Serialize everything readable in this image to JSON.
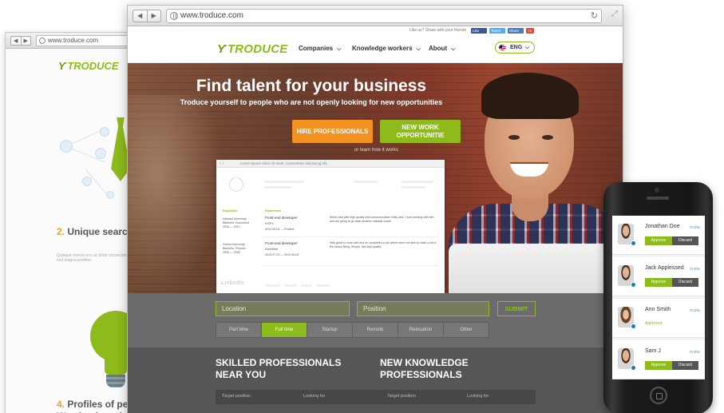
{
  "back_browser": {
    "url": "www.troduce.com",
    "logo_text": "TRODUCE",
    "section2": {
      "number": "2.",
      "text": "Unique search capabilities"
    },
    "section2_small": "Quisque viverra orci ac dolor consectetur adipiscing elit. Sed molestie id mi velyu at sed magna porttitor.",
    "section4": {
      "number": "4.",
      "text": "Profiles of perfect high quality. We check each profile ma"
    }
  },
  "browser": {
    "url": "www.troduce.com",
    "topbar": {
      "share_text": "Like us? Share with your friends",
      "like": "Like",
      "tweet": "Tweet",
      "share": "Share",
      "plus": "+1"
    },
    "header": {
      "logo_text": "TRODUCE",
      "menu": [
        "Companies",
        "Knowledge workers",
        "About"
      ],
      "lang": "ENG"
    },
    "hero": {
      "title": "Find talent for your business",
      "subtitle": "Troduce yourself to people who are not openly looking for new opportunities",
      "hire_button": "HIRE PROFESSIONALS",
      "new_work_button": "NEW WORK OPPORTUNITIE",
      "learn_link": "or learn how it works"
    },
    "resume_card": {
      "bar_text": "Lorem ipsum dolor sit amet, consectetur adipiscing elit.",
      "education_label": "Education",
      "experience_label": "Experience",
      "edu1": "Harvard University\nBachelor, Economist\n2005 — 2010",
      "edu2": "Oxford University\nBachelor, Physics\n2000 — 2005",
      "job1": "Front-end developer",
      "job1_company": "IHOPx",
      "job1_dates": "2012-05-04 — Present",
      "job2": "Front-end developer",
      "job2_company": "EarthWeb",
      "job2_dates": "2010-07-23 — 2012-05-04",
      "job1_desc": "Works fast with high quality and communicative really well. I love working with him and am going to go back another rockstar coder!",
      "job2_desc": "Was great to work with and he completed a job where were not able to make a lot of the heavy lifting. Simple, fast and quality.",
      "linkedin": "LinkedIn"
    },
    "search": {
      "location_placeholder": "Location",
      "position_placeholder": "Position",
      "submit": "SUBMIT",
      "tabs": [
        "Part time",
        "Full time",
        "Startup",
        "Remote",
        "Relocation",
        "Other"
      ],
      "active_tab": "Full time"
    },
    "sections": {
      "left_title": "SKILLED PROFESSIONALS NEAR YOU",
      "right_title": "NEW KNOWLEDGE PROFESSIONALS",
      "headers": [
        "Target position",
        "Looking for",
        "Target position",
        "Looking for"
      ]
    }
  },
  "phone": {
    "cards": [
      {
        "name": "Jonathan Doe",
        "profile": "Profile",
        "state": "buttons",
        "approve": "Approve",
        "discard": "Discard"
      },
      {
        "name": "Jack Applessed",
        "profile": "Profile",
        "state": "buttons",
        "approve": "Approve",
        "discard": "Discard"
      },
      {
        "name": "Ann Smith",
        "profile": "Profile",
        "state": "approved",
        "approved_label": "Approved"
      },
      {
        "name": "Sam J",
        "profile": "Profile",
        "state": "buttons",
        "approve": "Approve",
        "discard": "Discard"
      }
    ]
  },
  "colors": {
    "brand_green": "#8dbb1c",
    "orange": "#f39121",
    "search_band": "#6b6b6b",
    "dark_band": "#565656"
  }
}
